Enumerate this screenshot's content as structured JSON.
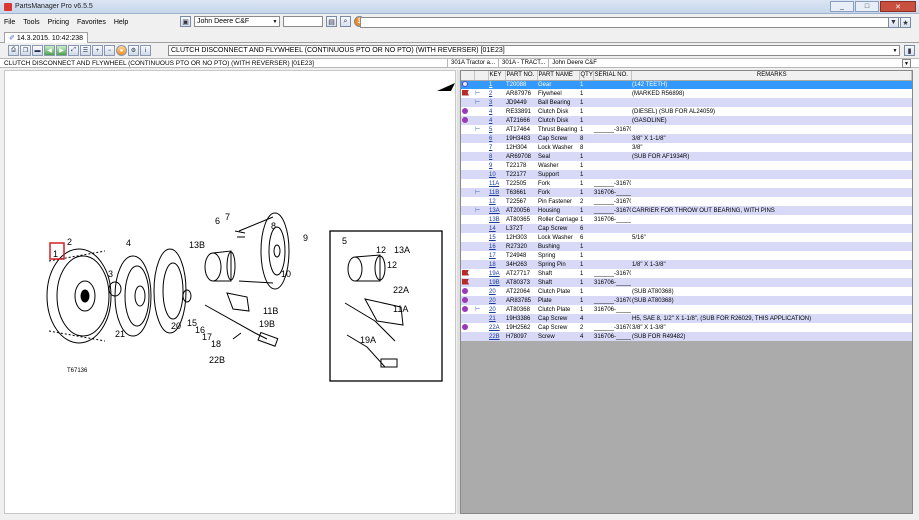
{
  "window": {
    "title": "PartsManager Pro v6.5.5",
    "min": "_",
    "max": "□",
    "close": "✕"
  },
  "menu": [
    "File",
    "Tools",
    "Pricing",
    "Favorites",
    "Help"
  ],
  "dealer": {
    "selected": "John Deere C&F"
  },
  "tab": {
    "label": "14.3.2015. 10:42:238"
  },
  "path": {
    "selected": "CLUTCH DISCONNECT AND FLYWHEEL (CONTINUOUS PTO OR NO PTO) (WITH REVERSER) [01E23]"
  },
  "info": {
    "page_title": "CLUTCH DISCONNECT AND FLYWHEEL (CONTINUOUS PTO OR NO PTO) (WITH REVERSER) [01E23]",
    "crumbs": [
      "301A Tractor a...",
      "301A - TRACT...",
      "John Deere C&F"
    ]
  },
  "diagram": {
    "callouts": [
      "2",
      "4",
      "3",
      "21",
      "20",
      "15",
      "16",
      "17",
      "18",
      "22B",
      "19B",
      "11B",
      "13B",
      "6",
      "7",
      "8",
      "9",
      "10",
      "5",
      "12",
      "13A",
      "12",
      "22A",
      "11A",
      "19A",
      "1"
    ],
    "figure_code": "T67136"
  },
  "grid": {
    "columns": [
      "",
      "KEY",
      "PART NO.",
      "PART NAME",
      "QTY",
      "SERIAL NO.",
      "REMARKS"
    ],
    "rows": [
      {
        "mark": "dot",
        "tree": false,
        "key": "1",
        "part": "T20088",
        "name": "Gear",
        "qty": "1",
        "serial": "",
        "remarks": "(142 TEETH)"
      },
      {
        "mark": "flag",
        "tree": true,
        "key": "2",
        "part": "AR87976",
        "name": "Flywheel",
        "qty": "1",
        "serial": "",
        "remarks": "(MARKED R56898)"
      },
      {
        "mark": "",
        "tree": true,
        "key": "3",
        "part": "JD9449",
        "name": "Ball Bearing",
        "qty": "1",
        "serial": "",
        "remarks": ""
      },
      {
        "mark": "gear",
        "tree": false,
        "key": "4",
        "part": "RE33891",
        "name": "Clutch Disk",
        "qty": "1",
        "serial": "",
        "remarks": "(DIESEL) (SUB FOR AL24059)"
      },
      {
        "mark": "gear",
        "tree": false,
        "key": "4",
        "part": "AT21666",
        "name": "Clutch Disk",
        "qty": "1",
        "serial": "",
        "remarks": "(GASOLINE)"
      },
      {
        "mark": "",
        "tree": true,
        "key": "5",
        "part": "AT17464",
        "name": "Thrust Bearing",
        "qty": "1",
        "serial": "______-316705",
        "remarks": ""
      },
      {
        "mark": "",
        "tree": false,
        "key": "6",
        "part": "19H3483",
        "name": "Cap Screw",
        "qty": "8",
        "serial": "",
        "remarks": "3/8\" X 1-1/8\""
      },
      {
        "mark": "",
        "tree": false,
        "key": "7",
        "part": "12H304",
        "name": "Lock Washer",
        "qty": "8",
        "serial": "",
        "remarks": "3/8\""
      },
      {
        "mark": "",
        "tree": false,
        "key": "8",
        "part": "AR69708",
        "name": "Seal",
        "qty": "1",
        "serial": "",
        "remarks": "(SUB FOR AF1934R)"
      },
      {
        "mark": "",
        "tree": false,
        "key": "9",
        "part": "T22178",
        "name": "Washer",
        "qty": "1",
        "serial": "",
        "remarks": ""
      },
      {
        "mark": "",
        "tree": false,
        "key": "10",
        "part": "T22177",
        "name": "Support",
        "qty": "1",
        "serial": "",
        "remarks": ""
      },
      {
        "mark": "",
        "tree": false,
        "key": "11A",
        "part": "T22505",
        "name": "Fork",
        "qty": "1",
        "serial": "______-316705",
        "remarks": ""
      },
      {
        "mark": "",
        "tree": true,
        "key": "11B",
        "part": "T63661",
        "name": "Fork",
        "qty": "1",
        "serial": "316706-______",
        "remarks": ""
      },
      {
        "mark": "",
        "tree": false,
        "key": "12",
        "part": "T22567",
        "name": "Pin Fastener",
        "qty": "2",
        "serial": "______-316705",
        "remarks": ""
      },
      {
        "mark": "",
        "tree": true,
        "key": "13A",
        "part": "AT20056",
        "name": "Housing",
        "qty": "1",
        "serial": "______-316705",
        "remarks": "CARRIER FOR THROW OUT BEARING, WITH PINS"
      },
      {
        "mark": "",
        "tree": false,
        "key": "13B",
        "part": "AT80365",
        "name": "Roller Carriage",
        "qty": "1",
        "serial": "316706-______",
        "remarks": ""
      },
      {
        "mark": "",
        "tree": false,
        "key": "14",
        "part": "L372T",
        "name": "Cap Screw",
        "qty": "6",
        "serial": "",
        "remarks": ""
      },
      {
        "mark": "",
        "tree": false,
        "key": "15",
        "part": "12H303",
        "name": "Lock Washer",
        "qty": "6",
        "serial": "",
        "remarks": "5/16\""
      },
      {
        "mark": "",
        "tree": false,
        "key": "16",
        "part": "R27320",
        "name": "Bushing",
        "qty": "1",
        "serial": "",
        "remarks": ""
      },
      {
        "mark": "",
        "tree": false,
        "key": "17",
        "part": "T24948",
        "name": "Spring",
        "qty": "1",
        "serial": "",
        "remarks": ""
      },
      {
        "mark": "",
        "tree": false,
        "key": "18",
        "part": "34H263",
        "name": "Spring Pin",
        "qty": "1",
        "serial": "",
        "remarks": "1/8\" X 1-3/8\""
      },
      {
        "mark": "flag",
        "tree": false,
        "key": "19A",
        "part": "AT27717",
        "name": "Shaft",
        "qty": "1",
        "serial": "______-316705",
        "remarks": ""
      },
      {
        "mark": "flag",
        "tree": false,
        "key": "19B",
        "part": "AT80373",
        "name": "Shaft",
        "qty": "1",
        "serial": "316706-______",
        "remarks": ""
      },
      {
        "mark": "gear",
        "tree": false,
        "key": "20",
        "part": "AT22064",
        "name": "Clutch Plate",
        "qty": "1",
        "serial": "",
        "remarks": "(SUB AT80368)"
      },
      {
        "mark": "gear",
        "tree": false,
        "key": "20",
        "part": "AR83785",
        "name": "Plate",
        "qty": "1",
        "serial": "______-316705",
        "remarks": "(SUB AT80368)"
      },
      {
        "mark": "gear",
        "tree": true,
        "key": "20",
        "part": "AT80368",
        "name": "Clutch Plate",
        "qty": "1",
        "serial": "316706-______",
        "remarks": ""
      },
      {
        "mark": "",
        "tree": false,
        "key": "21",
        "part": "19H3386",
        "name": "Cap Screw",
        "qty": "4",
        "serial": "",
        "remarks": "H5, SAE 8, 1/2\" X 1-1/8\", (SUB FOR R26029, THIS APPLICATION)"
      },
      {
        "mark": "gear",
        "tree": false,
        "key": "22A",
        "part": "19H2562",
        "name": "Cap Screw",
        "qty": "2",
        "serial": "______-316705",
        "remarks": "3/8\" X 1-3/8\""
      },
      {
        "mark": "",
        "tree": false,
        "key": "22B",
        "part": "H78097",
        "name": "Screw",
        "qty": "4",
        "serial": "316706-______",
        "remarks": "(SUB FOR R49482)"
      }
    ]
  },
  "colors": {
    "selected_row": "#3399ff",
    "alt_row": "#d8d9f7",
    "key_link": "#1a3c9a",
    "callout_box": "#d22222"
  }
}
